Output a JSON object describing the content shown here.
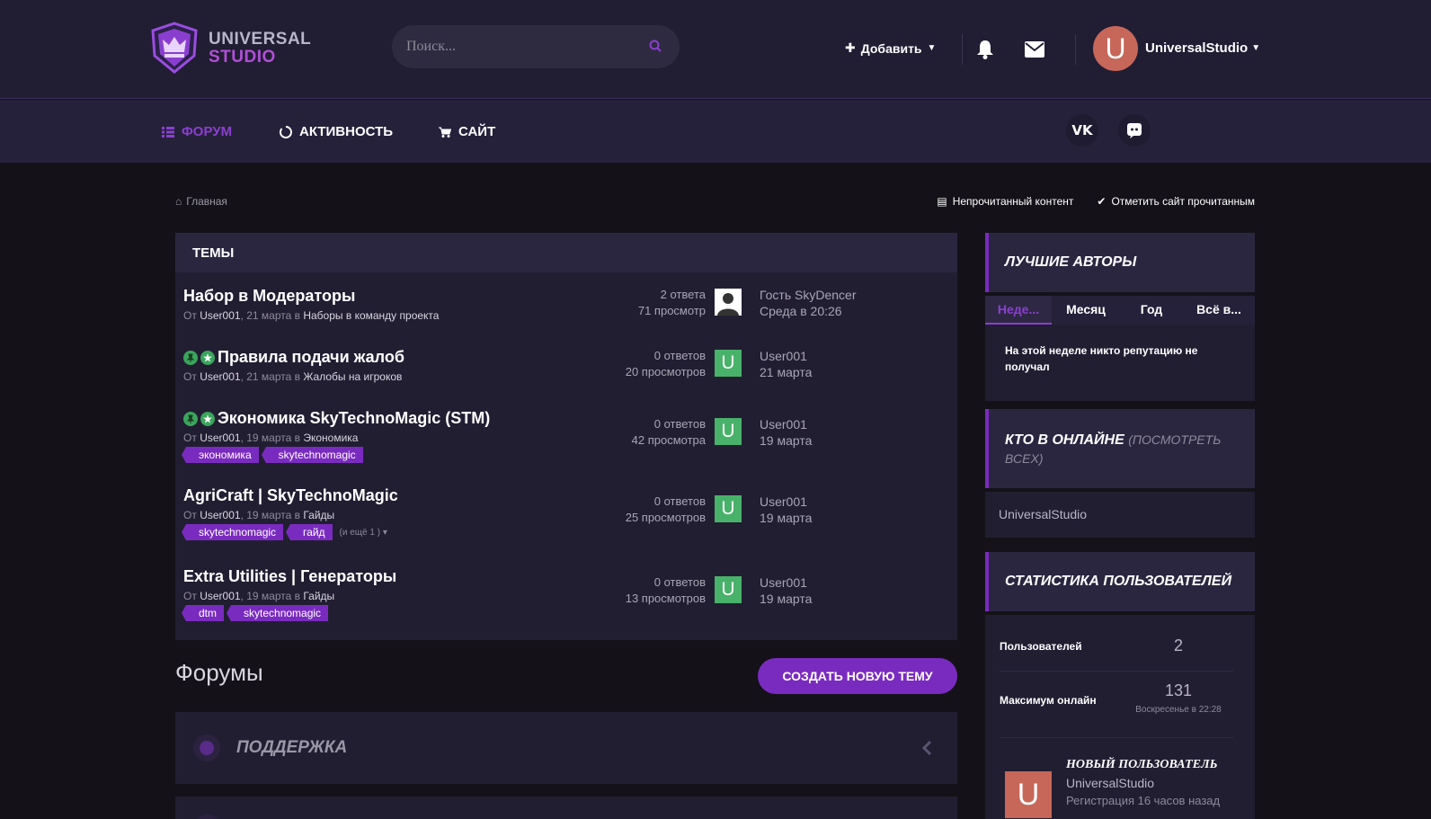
{
  "header": {
    "logo_line1": "UNIVERSAL",
    "logo_line2": "STUDIO",
    "search_placeholder": "Поиск...",
    "add_label": "Добавить",
    "avatar_letter": "U",
    "username": "UniversalStudio"
  },
  "nav": {
    "forum": "ФОРУМ",
    "activity": "АКТИВНОСТЬ",
    "site": "САЙТ"
  },
  "breadcrumb": {
    "home": "Главная",
    "unread": "Непрочитанный контент",
    "mark_read": "Отметить сайт прочитанным"
  },
  "topics": {
    "heading": "ТЕМЫ",
    "items": [
      {
        "title": "Набор в Модераторы",
        "by": "От",
        "author": "User001",
        "date": "21 марта",
        "in": "в",
        "forum": "Наборы в команду проекта",
        "replies": "2 ответа",
        "views": "71 просмотр",
        "last_user": "Гость SkyDencer",
        "last_date": "Среда в 20:26"
      },
      {
        "title": "Правила подачи жалоб",
        "by": "От",
        "author": "User001",
        "date": "21 марта",
        "in": "в",
        "forum": "Жалобы на игроков",
        "replies": "0 ответов",
        "views": "20 просмотров",
        "avatar": "U",
        "last_user": "User001",
        "last_date": "21 марта"
      },
      {
        "title": "Экономика SkyTechnoMagic (STM)",
        "by": "От",
        "author": "User001",
        "date": "19 марта",
        "in": "в",
        "forum": "Экономика",
        "tags": [
          "экономика",
          "skytechnomagic"
        ],
        "replies": "0 ответов",
        "views": "42 просмотра",
        "avatar": "U",
        "last_user": "User001",
        "last_date": "19 марта"
      },
      {
        "title": "AgriCraft | SkyTechnoMagic",
        "by": "От",
        "author": "User001",
        "date": "19 марта",
        "in": "в",
        "forum": "Гайды",
        "tags": [
          "skytechnomagic",
          "гайд"
        ],
        "more_tags": "(и ещё 1 )",
        "replies": "0 ответов",
        "views": "25 просмотров",
        "avatar": "U",
        "last_user": "User001",
        "last_date": "19 марта"
      },
      {
        "title": "Extra Utilities | Генераторы",
        "by": "От",
        "author": "User001",
        "date": "19 марта",
        "in": "в",
        "forum": "Гайды",
        "tags": [
          "dtm",
          "skytechnomagic"
        ],
        "replies": "0 ответов",
        "views": "13 просмотров",
        "avatar": "U",
        "last_user": "User001",
        "last_date": "19 марта"
      }
    ]
  },
  "forums": {
    "title": "Форумы",
    "create_button": "СОЗДАТЬ НОВУЮ ТЕМУ",
    "support": "ПОДДЕРЖКА"
  },
  "sidebar": {
    "top_authors": {
      "title": "ЛУЧШИЕ АВТОРЫ",
      "tabs": [
        "Неде...",
        "Месяц",
        "Год",
        "Всё в..."
      ],
      "empty_text": "На этой неделе никто репутацию не получал"
    },
    "online": {
      "title": "КТО В ОНЛАЙНЕ",
      "view_all": "(ПОСМОТРЕТЬ ВСЕХ)",
      "user": "UniversalStudio"
    },
    "stats": {
      "title": "СТАТИСТИКА ПОЛЬЗОВАТЕЛЕЙ",
      "users_label": "Пользователей",
      "users_value": "2",
      "max_online_label": "Максимум онлайн",
      "max_online_value": "131",
      "max_online_when": "Воскресенье в 22:28",
      "new_user_label": "НОВЫЙ ПОЛЬЗОВАТЕЛЬ",
      "new_user_name": "UniversalStudio",
      "new_user_reg": "Регистрация 16 часов назад",
      "new_user_avatar": "U"
    }
  },
  "colors": {
    "accent": "#7a2bbf",
    "header_bg": "#211d33",
    "panel_bg": "#221e32",
    "avatar_green": "#49b26a"
  }
}
